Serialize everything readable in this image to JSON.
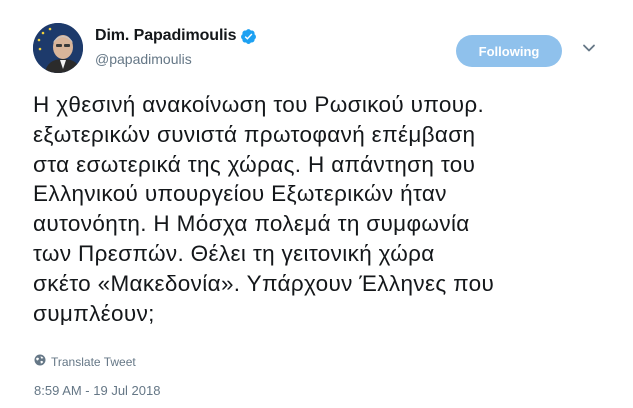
{
  "author": {
    "display_name": "Dim. Papadimoulis",
    "handle": "@papadimoulis",
    "verified_icon": "verified-badge-icon"
  },
  "actions": {
    "follow_label": "Following",
    "more_icon": "chevron-down-icon"
  },
  "tweet": {
    "text": "Η χθεσινή ανακοίνωση του Ρωσικού υπουρ.\nεξωτερικών συνιστά πρωτοφανή επέμβαση\nστα εσωτερικά της χώρας. Η απάντηση του\nΕλληνικού υπουργείου Εξωτερικών ήταν\nαυτονόητη. Η Μόσχα πολεμά τη συμφωνία\nτων Πρεσπών. Θέλει τη γειτονική χώρα\nσκέτο «Μακεδονία». Υπάρχουν Έλληνες που\nσυμπλέουν;",
    "translate_label": "Translate Tweet",
    "timestamp": "8:59 AM - 19 Jul 2018"
  },
  "colors": {
    "follow_button": "#8fc1ec",
    "verified": "#1da1f2",
    "secondary_text": "#657786"
  }
}
